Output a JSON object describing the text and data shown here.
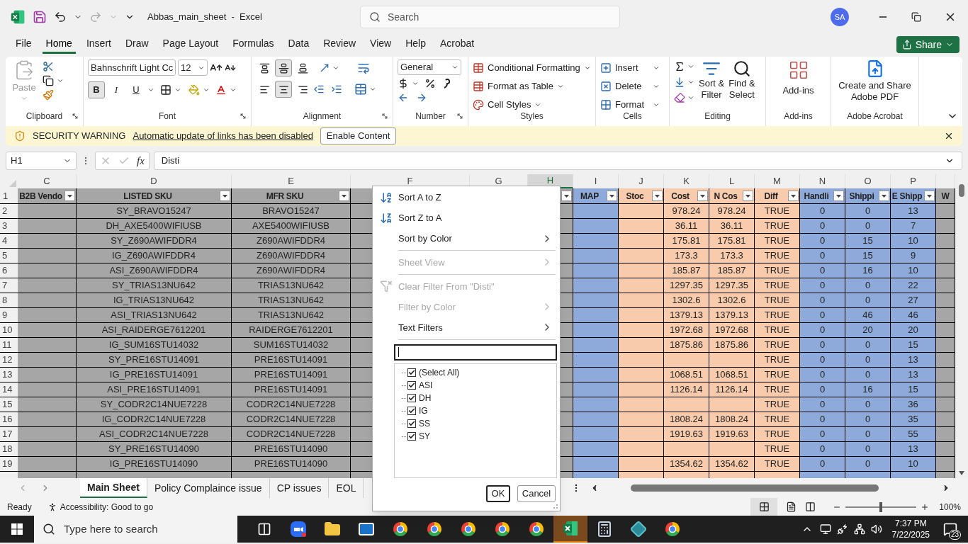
{
  "window": {
    "title": "Abbas_main_sheet  -  Excel",
    "search_placeholder": "Search",
    "avatar": "SA"
  },
  "menu": {
    "tabs": [
      {
        "label": "File",
        "selected": false
      },
      {
        "label": "Home",
        "selected": true
      },
      {
        "label": "Insert",
        "selected": false
      },
      {
        "label": "Draw",
        "selected": false
      },
      {
        "label": "Page Layout",
        "selected": false
      },
      {
        "label": "Formulas",
        "selected": false
      },
      {
        "label": "Data",
        "selected": false
      },
      {
        "label": "Review",
        "selected": false
      },
      {
        "label": "View",
        "selected": false
      },
      {
        "label": "Help",
        "selected": false
      },
      {
        "label": "Acrobat",
        "selected": false
      }
    ],
    "share": "Share"
  },
  "ribbon": {
    "clipboard": {
      "label": "Clipboard",
      "paste": "Paste"
    },
    "font": {
      "label": "Font",
      "font_name": "Bahnschrift Light Cc",
      "font_size": "12",
      "styles": [
        {
          "label": "B",
          "pressed": true
        },
        {
          "label": "I",
          "pressed": false
        },
        {
          "label": "U",
          "pressed": false
        }
      ]
    },
    "alignment": {
      "label": "Alignment",
      "vertical": [
        {
          "pressed": false
        },
        {
          "pressed": true
        },
        {
          "pressed": false
        }
      ],
      "horizontal": [
        {
          "pressed": false
        },
        {
          "pressed": true
        },
        {
          "pressed": false
        }
      ]
    },
    "number": {
      "label": "Number",
      "format": "General"
    },
    "styles": {
      "label": "Styles",
      "commands": [
        "Conditional Formatting",
        "Format as Table",
        "Cell Styles"
      ]
    },
    "cells": {
      "label": "Cells",
      "commands": [
        "Insert",
        "Delete",
        "Format"
      ]
    },
    "editing": {
      "label": "Editing",
      "sort_filter": [
        "Sort &",
        "Filter"
      ],
      "find_select": [
        "Find &",
        "Select"
      ]
    },
    "addins": {
      "label": "Add-ins",
      "button": "Add-ins"
    },
    "acrobat": {
      "label": "Adobe Acrobat",
      "button": [
        "Create and Share",
        "Adobe PDF"
      ]
    }
  },
  "security_bar": {
    "title": "SECURITY WARNING",
    "message": "Automatic update of links has been disabled",
    "button": "Enable Content"
  },
  "formula_bar": {
    "name_box": "H1",
    "fx": "fx",
    "value": "Disti"
  },
  "grid": {
    "columns": [
      {
        "letter": "C",
        "color": "#a6a6a6",
        "selected": false
      },
      {
        "letter": "D",
        "color": "#a6a6a6",
        "selected": false
      },
      {
        "letter": "E",
        "color": "#a6a6a6",
        "selected": false
      },
      {
        "letter": "F",
        "color": "#a6a6a6",
        "selected": false
      },
      {
        "letter": "G",
        "selected": false
      },
      {
        "letter": "H",
        "color": "#a6a6a6",
        "selected": true
      },
      {
        "letter": "I",
        "color": "#8eaadb",
        "selected": false
      },
      {
        "letter": "J",
        "color": "#f8cbad",
        "selected": false
      },
      {
        "letter": "K",
        "color": "#f8cbad",
        "selected": false
      },
      {
        "letter": "L",
        "color": "#f8cbad",
        "selected": false
      },
      {
        "letter": "M",
        "color": "#f8cbad",
        "selected": false
      },
      {
        "letter": "N",
        "color": "#8eaadb",
        "selected": false
      },
      {
        "letter": "O",
        "color": "#8eaadb",
        "selected": false
      },
      {
        "letter": "P",
        "color": "#8eaadb",
        "selected": false
      },
      {
        "color": "#a6a6a6"
      }
    ],
    "header_row": {
      "num": "1",
      "cells": [
        {
          "text": "B2B Vendo",
          "filter": true
        },
        {
          "text": "LISTED SKU",
          "filter": true
        },
        {
          "text": "MFR SKU",
          "filter": true
        },
        null,
        null,
        {
          "filter": true
        },
        {
          "text": "MAP",
          "filter": true
        },
        {
          "text": "Stoc",
          "filter": true
        },
        {
          "text": "Cost",
          "filter": true
        },
        {
          "text": "N Cos",
          "filter": true
        },
        {
          "text": "Diff",
          "filter": true
        },
        {
          "text": "Handli",
          "filter": true
        },
        {
          "text": "Shippi",
          "filter": true
        },
        {
          "text": "E Shipp",
          "filter": true
        },
        {
          "text": "W",
          "filter": false
        }
      ]
    },
    "rows": [
      {
        "num": "2",
        "cells": [
          null,
          "SY_BRAVO15247",
          "BRAVO15247",
          null,
          null,
          null,
          null,
          null,
          "978.24",
          "978.24",
          "TRUE",
          "0",
          "0",
          "13",
          null
        ]
      },
      {
        "num": "3",
        "cells": [
          null,
          "DH_AXE5400WIFIUSB",
          "AXE5400WIFIUSB",
          null,
          null,
          null,
          null,
          null,
          "36.11",
          "36.11",
          "TRUE",
          "0",
          "0",
          "7",
          null
        ]
      },
      {
        "num": "4",
        "cells": [
          null,
          "SY_Z690AWIFDDR4",
          "Z690AWIFDDR4",
          null,
          null,
          null,
          null,
          null,
          "175.81",
          "175.81",
          "TRUE",
          "0",
          "15",
          "10",
          null
        ]
      },
      {
        "num": "5",
        "cells": [
          null,
          "IG_Z690AWIFDDR4",
          "Z690AWIFDDR4",
          null,
          null,
          null,
          null,
          null,
          "173.3",
          "173.3",
          "TRUE",
          "0",
          "15",
          "9",
          null
        ]
      },
      {
        "num": "6",
        "cells": [
          null,
          "ASI_Z690AWIFDDR4",
          "Z690AWIFDDR4",
          null,
          null,
          null,
          null,
          null,
          "185.87",
          "185.87",
          "TRUE",
          "0",
          "16",
          "10",
          null
        ]
      },
      {
        "num": "7",
        "cells": [
          null,
          "SY_TRIAS13NU642",
          "TRIAS13NU642",
          null,
          null,
          null,
          null,
          null,
          "1297.35",
          "1297.35",
          "TRUE",
          "0",
          "0",
          "22",
          null
        ]
      },
      {
        "num": "8",
        "cells": [
          null,
          "IG_TRIAS13NU642",
          "TRIAS13NU642",
          null,
          null,
          null,
          null,
          null,
          "1302.6",
          "1302.6",
          "TRUE",
          "0",
          "0",
          "27",
          null
        ]
      },
      {
        "num": "9",
        "cells": [
          null,
          "ASI_TRIAS13NU642",
          "TRIAS13NU642",
          null,
          null,
          null,
          null,
          null,
          "1379.13",
          "1379.13",
          "TRUE",
          "0",
          "46",
          "46",
          null
        ]
      },
      {
        "num": "10",
        "cells": [
          null,
          "ASI_RAIDERGE7612201",
          "RAIDERGE7612201",
          null,
          null,
          null,
          null,
          null,
          "1972.68",
          "1972.68",
          "TRUE",
          "0",
          "20",
          "20",
          null
        ]
      },
      {
        "num": "11",
        "cells": [
          null,
          "IG_SUM16STU14032",
          "SUM16STU14032",
          null,
          null,
          null,
          null,
          null,
          "1875.86",
          "1875.86",
          "TRUE",
          "0",
          "0",
          "15",
          null
        ]
      },
      {
        "num": "12",
        "cells": [
          null,
          "SY_PRE16STU14091",
          "PRE16STU14091",
          null,
          null,
          null,
          null,
          null,
          null,
          null,
          "TRUE",
          "0",
          "0",
          "13",
          null
        ]
      },
      {
        "num": "13",
        "cells": [
          null,
          "IG_PRE16STU14091",
          "PRE16STU14091",
          null,
          null,
          null,
          null,
          null,
          "1068.51",
          "1068.51",
          "TRUE",
          "0",
          "0",
          "13",
          null
        ]
      },
      {
        "num": "14",
        "cells": [
          null,
          "ASI_PRE16STU14091",
          "PRE16STU14091",
          null,
          null,
          null,
          null,
          null,
          "1126.14",
          "1126.14",
          "TRUE",
          "0",
          "16",
          "15",
          null
        ]
      },
      {
        "num": "15",
        "cells": [
          null,
          "SY_CODR2C14NUE7228",
          "CODR2C14NUE7228",
          null,
          null,
          null,
          null,
          null,
          null,
          null,
          "TRUE",
          "0",
          "0",
          "36",
          null
        ]
      },
      {
        "num": "16",
        "cells": [
          null,
          "IG_CODR2C14NUE7228",
          "CODR2C14NUE7228",
          null,
          null,
          null,
          null,
          null,
          "1808.24",
          "1808.24",
          "TRUE",
          "0",
          "0",
          "35",
          null
        ]
      },
      {
        "num": "17",
        "cells": [
          null,
          "ASI_CODR2C14NUE7228",
          "CODR2C14NUE7228",
          null,
          null,
          null,
          null,
          null,
          "1919.63",
          "1919.63",
          "TRUE",
          "0",
          "0",
          "55",
          null
        ]
      },
      {
        "num": "18",
        "cells": [
          null,
          "SY_PRE16STU14090",
          "PRE16STU14090",
          null,
          null,
          null,
          null,
          null,
          null,
          null,
          "TRUE",
          "0",
          "0",
          "13",
          null
        ]
      },
      {
        "num": "19",
        "cells": [
          null,
          "IG_PRE16STU14090",
          "PRE16STU14090",
          null,
          null,
          null,
          null,
          null,
          "1354.62",
          "1354.62",
          "TRUE",
          "0",
          "0",
          "10",
          null
        ]
      }
    ]
  },
  "filter_menu": {
    "items": [
      {
        "kind": "sort-asc",
        "label": "Sort A to Z",
        "disabled": false
      },
      {
        "kind": "sort-desc",
        "label": "Sort Z to A",
        "disabled": false
      },
      {
        "kind": "submenu",
        "label": "Sort by Color",
        "disabled": false
      },
      {
        "kind": "separator"
      },
      {
        "kind": "submenu",
        "label": "Sheet View",
        "disabled": true
      },
      {
        "kind": "separator"
      },
      {
        "kind": "clear-filter",
        "label": "Clear Filter From \"Disti\"",
        "disabled": true
      },
      {
        "kind": "submenu",
        "label": "Filter by Color",
        "disabled": true
      },
      {
        "kind": "submenu",
        "label": "Text Filters",
        "disabled": false
      },
      {
        "kind": "separator"
      }
    ],
    "values": [
      {
        "label": "(Select All)",
        "checked": true
      },
      {
        "label": "ASI",
        "checked": true
      },
      {
        "label": "DH",
        "checked": true
      },
      {
        "label": "IG",
        "checked": true
      },
      {
        "label": "SS",
        "checked": true
      },
      {
        "label": "SY",
        "checked": true
      }
    ],
    "ok": "OK",
    "cancel": "Cancel"
  },
  "sheet_tabs": [
    {
      "label": "Main Sheet",
      "selected": true
    },
    {
      "label": "Policy Complaince issue",
      "selected": false
    },
    {
      "label": "CP issues",
      "selected": false
    },
    {
      "label": "EOL",
      "selected": false
    }
  ],
  "status_bar": {
    "mode": "Ready",
    "accessibility": "Accessibility: Good to go",
    "zoom": {
      "level": 0.5,
      "reading": "100%"
    }
  },
  "taskbar": {
    "search_placeholder": "Type here to search",
    "apps": [
      {
        "kind": "task-view",
        "active": false
      },
      {
        "kind": "video",
        "active": false
      },
      {
        "kind": "folder",
        "active": false
      },
      {
        "kind": "mail",
        "active": false
      },
      {
        "kind": "browser",
        "active": false
      },
      {
        "kind": "browser",
        "active": false
      },
      {
        "kind": "browser",
        "active": false
      },
      {
        "kind": "browser",
        "active": false
      },
      {
        "kind": "browser",
        "active": false
      },
      {
        "kind": "spreadsheet",
        "active": true
      },
      {
        "kind": "calculator",
        "active": false
      },
      {
        "kind": "diamond",
        "active": false
      },
      {
        "kind": "browser",
        "active": false
      }
    ],
    "time": "7:37 PM",
    "date": "7/22/2025",
    "notifications": "23"
  }
}
